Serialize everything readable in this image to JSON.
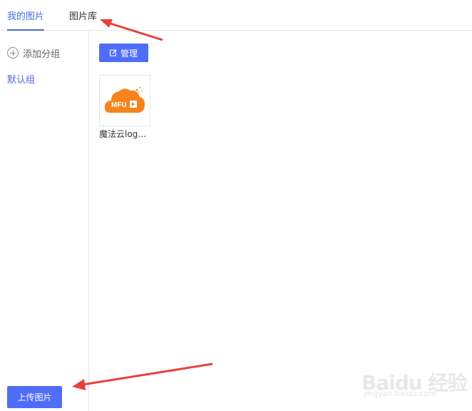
{
  "tabs": [
    {
      "label": "我的图片",
      "active": true
    },
    {
      "label": "图片库",
      "active": false
    }
  ],
  "sidebar": {
    "add_group_label": "添加分组",
    "groups": [
      {
        "label": "默认组",
        "active": true
      }
    ],
    "upload_label": "上传图片"
  },
  "toolbar": {
    "manage_label": "管理"
  },
  "images": [
    {
      "name": "魔法云logo...",
      "logo_text": "MFU",
      "logo_color": "#f5841f"
    }
  ],
  "watermark": {
    "brand": "Baidu 经验",
    "url": "jingyan.baidu.com"
  },
  "colors": {
    "accent": "#4f6ef7",
    "active_text": "#4a6bd8",
    "annotation_arrow": "#e8403a"
  }
}
